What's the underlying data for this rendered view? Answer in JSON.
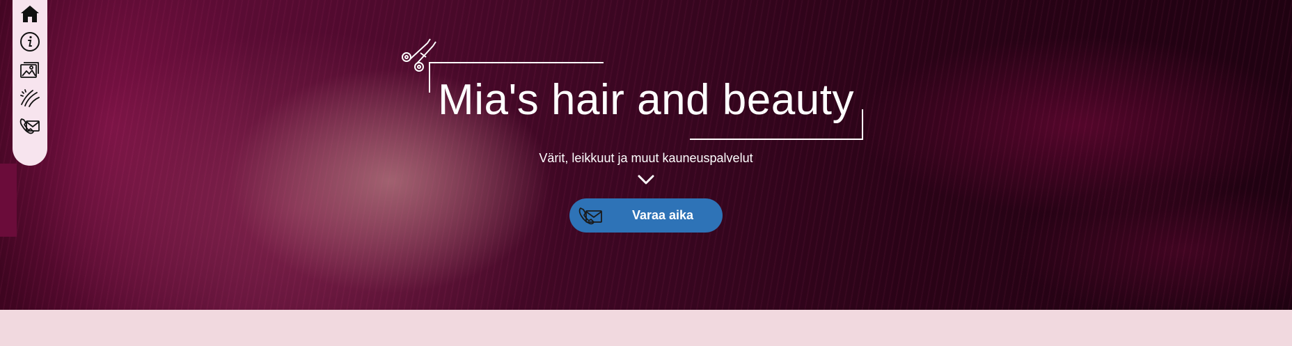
{
  "nav": {
    "items": [
      {
        "icon": "home-icon"
      },
      {
        "icon": "info-icon"
      },
      {
        "icon": "gallery-icon"
      },
      {
        "icon": "hair-strands-icon"
      },
      {
        "icon": "phone-mail-icon"
      }
    ]
  },
  "hero": {
    "title": "Mia's hair and beauty",
    "subtitle": "Värit, leikkuut ja muut kauneuspalvelut",
    "cta_label": "Varaa aika",
    "cta_icon": "phone-mail-icon",
    "decor_icon": "scissors-icon",
    "scroll_icon": "chevron-down-icon"
  },
  "colors": {
    "cta_background": "#2e73b7",
    "nav_background": "#f7e4ee",
    "page_background": "#f1d9df",
    "hero_dark": "#2a0317"
  }
}
